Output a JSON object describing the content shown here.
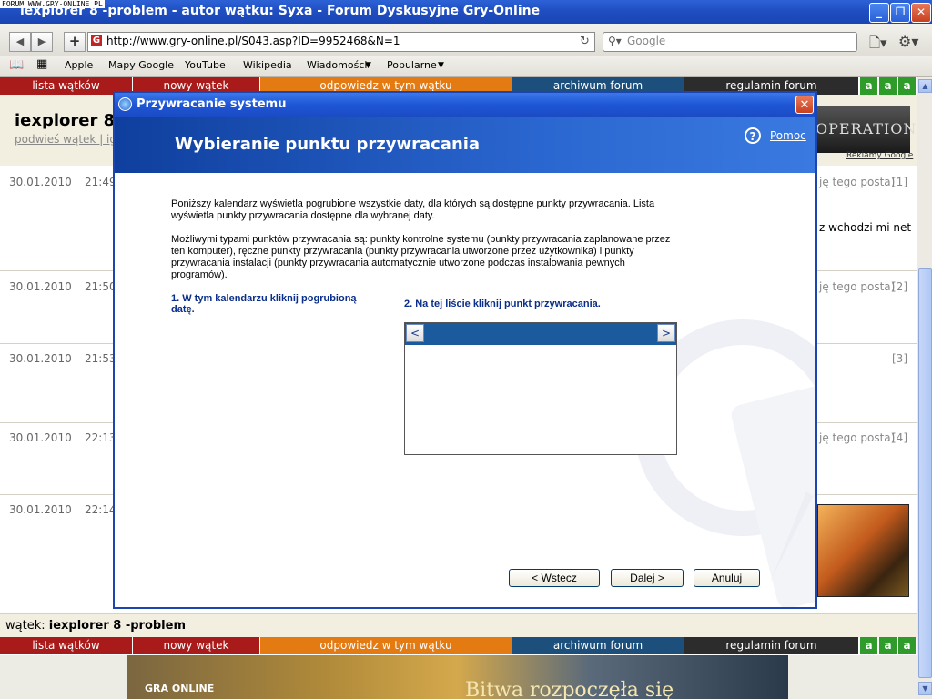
{
  "browser": {
    "corner_tag": "FORUM WWW.GRY-ONLINE.PL",
    "window_title": "iexplorer 8 -problem - autor wątku: Syxa - Forum Dyskusyjne Gry-Online",
    "url": "http://www.gry-online.pl/S043.asp?ID=9952468&N=1",
    "search_placeholder": "Google",
    "bookmarks": [
      "Apple",
      "Mapy Google",
      "YouTube",
      "Wikipedia",
      "Wiadomości",
      "Popularne"
    ]
  },
  "forum": {
    "nav": [
      "lista wątków",
      "nowy wątek",
      "odpowiedz w tym wątku",
      "archiwum forum",
      "regulamin forum"
    ],
    "font_sizes": [
      "a",
      "a",
      "a"
    ],
    "thread_title": "iexplorer 8 -",
    "thread_links": "podwieś wątek | ig",
    "ad_text": "OPERATIONS",
    "ad_label": "Reklamy Google",
    "posts": [
      {
        "date": "30.01.2010",
        "time": "21:49",
        "right": "ję tego posta)",
        "num": "[1]",
        "extra": "z wchodzi mi net"
      },
      {
        "date": "30.01.2010",
        "time": "21:50",
        "right": "ję tego posta)",
        "num": "[2]",
        "extra": ""
      },
      {
        "date": "30.01.2010",
        "time": "21:53",
        "right": "",
        "num": "[3]",
        "extra": ""
      },
      {
        "date": "30.01.2010",
        "time": "22:13",
        "right": "ję tego posta)",
        "num": "[4]",
        "extra": ""
      },
      {
        "date": "30.01.2010",
        "time": "22:14",
        "right": "",
        "num": "",
        "extra": ""
      }
    ],
    "bottom_label": "wątek:",
    "bottom_title": "iexplorer 8 -problem",
    "banner_left": "GRA ONLINE",
    "banner_text": "Bitwa rozpoczęła się"
  },
  "dialog": {
    "title": "Przywracanie systemu",
    "heading": "Wybieranie punktu przywracania",
    "help": "Pomoc",
    "para1": "Poniższy kalendarz wyświetla pogrubione wszystkie daty, dla których są dostępne punkty przywracania. Lista wyświetla punkty przywracania dostępne dla wybranej daty.",
    "para2": "Możliwymi typami punktów przywracania są: punkty kontrolne systemu (punkty przywracania zaplanowane przez ten komputer), ręczne punkty przywracania (punkty przywracania utworzone przez użytkownika) i punkty przywracania instalacji (punkty przywracania automatycznie utworzone podczas instalowania pewnych programów).",
    "step1": "1. W tym kalendarzu kliknij pogrubioną datę.",
    "step2": "2. Na tej liście kliknij punkt przywracania.",
    "prev_arrow": "<",
    "next_arrow": ">",
    "buttons": {
      "back": "< Wstecz",
      "next": "Dalej >",
      "cancel": "Anuluj"
    }
  }
}
